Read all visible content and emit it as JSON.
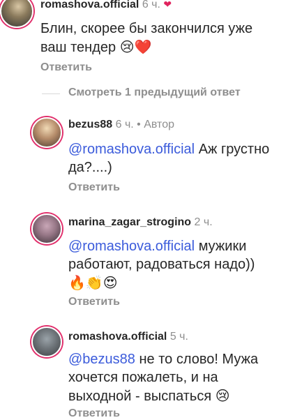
{
  "comments": [
    {
      "username": "romashova.official",
      "time": "6 ч.",
      "text": "Блин, скорее бы закончился уже ваш тендер",
      "emojis": "😢❤️",
      "reply_label": "Ответить"
    },
    {
      "username": "bezus88",
      "time": "6 ч.",
      "author_badge": "• Автор",
      "mention": "@romashova.official",
      "text": "Аж грустно да?....)",
      "reply_label": "Ответить"
    },
    {
      "username": "marina_zagar_strogino",
      "time": "2 ч.",
      "mention": "@romashova.official",
      "text": "мужики работают, радоваться надо))",
      "emojis": "🔥👏😍",
      "reply_label": "Ответить"
    },
    {
      "username": "romashova.official",
      "time": "5 ч.",
      "mention": "@bezus88",
      "text": "не то слово! Мужа хочется пожалеть, и на выходной - выспаться",
      "emojis": "😢",
      "reply_label": "Ответить"
    }
  ],
  "view_previous": "Смотреть 1 предыдущий ответ",
  "header_reaction": "❤"
}
